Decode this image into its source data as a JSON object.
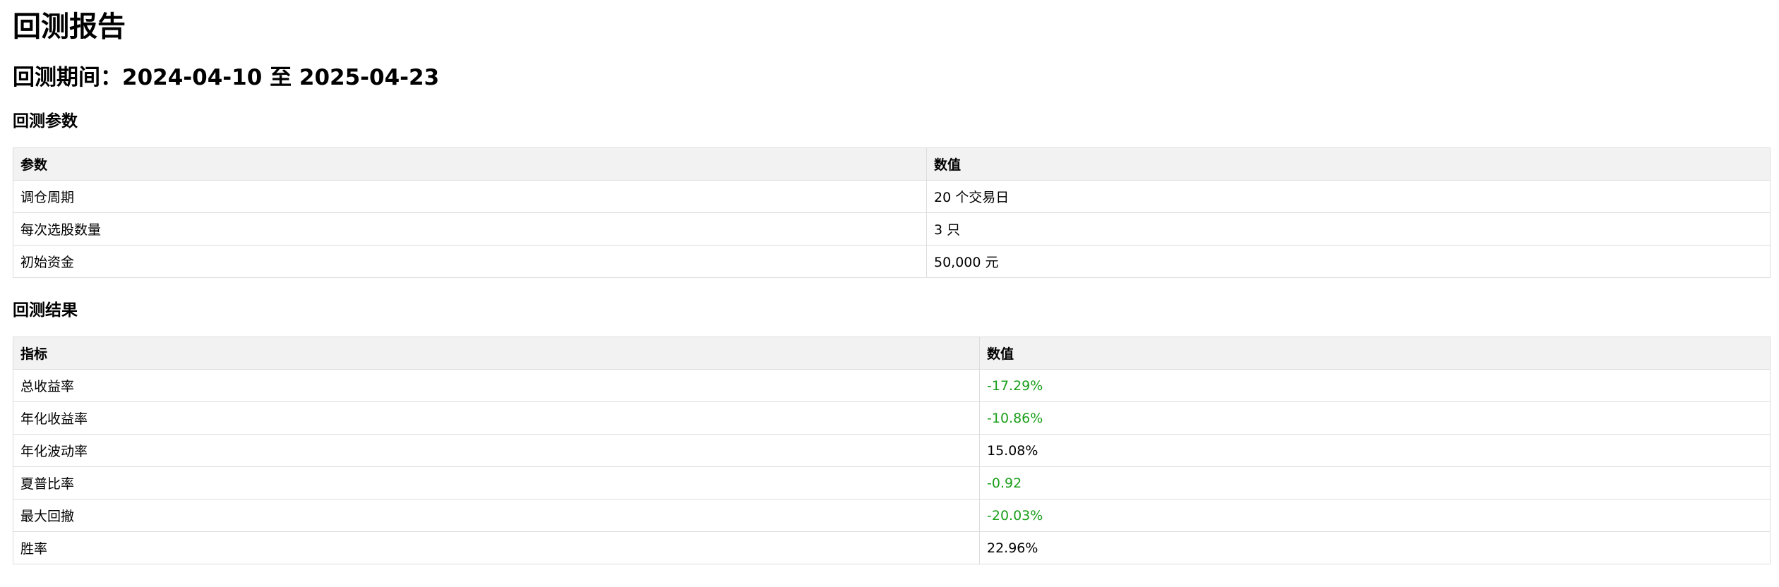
{
  "report": {
    "title": "回测报告",
    "period": {
      "label": "回测期间：",
      "start": "2024-04-10",
      "separator": "至",
      "end": "2025-04-23",
      "full": "回测期间：2024-04-10 至 2025-04-23"
    }
  },
  "params": {
    "heading": "回测参数",
    "headers": [
      "参数",
      "数值"
    ],
    "rows": [
      {
        "name": "调仓周期",
        "value": "20 个交易日"
      },
      {
        "name": "每次选股数量",
        "value": "3 只"
      },
      {
        "name": "初始资金",
        "value": "50,000 元"
      }
    ]
  },
  "results": {
    "heading": "回测结果",
    "headers": [
      "指标",
      "数值"
    ],
    "rows": [
      {
        "name": "总收益率",
        "value": "-17.29%",
        "sign": "negative"
      },
      {
        "name": "年化收益率",
        "value": "-10.86%",
        "sign": "negative"
      },
      {
        "name": "年化波动率",
        "value": "15.08%",
        "sign": "positive"
      },
      {
        "name": "夏普比率",
        "value": "-0.92",
        "sign": "negative"
      },
      {
        "name": "最大回撤",
        "value": "-20.03%",
        "sign": "negative"
      },
      {
        "name": "胜率",
        "value": "22.96%",
        "sign": "positive"
      }
    ]
  },
  "colors": {
    "negative_value": "#1a9f1a",
    "header_background": "#f2f2f2",
    "border": "#dddddd"
  }
}
